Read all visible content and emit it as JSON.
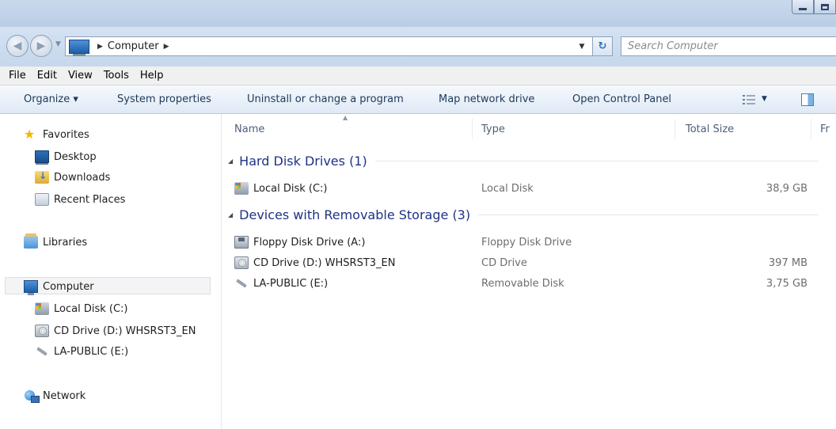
{
  "address": {
    "location": "Computer",
    "search_placeholder": "Search Computer"
  },
  "menu": [
    "File",
    "Edit",
    "View",
    "Tools",
    "Help"
  ],
  "commands": {
    "organize": "Organize ▾",
    "system_properties": "System properties",
    "uninstall": "Uninstall or change a program",
    "map_drive": "Map network drive",
    "control_panel": "Open Control Panel"
  },
  "nav": {
    "favorites": "Favorites",
    "desktop": "Desktop",
    "downloads": "Downloads",
    "recent": "Recent Places",
    "libraries": "Libraries",
    "computer": "Computer",
    "local_disk": "Local Disk (C:)",
    "cd_drive": "CD Drive (D:) WHSRST3_EN",
    "usb": "LA-PUBLIC (E:)",
    "network": "Network"
  },
  "columns": {
    "name": "Name",
    "type": "Type",
    "total_size": "Total Size",
    "free_space": "Fr"
  },
  "groups": {
    "hard_disks": "Hard Disk Drives (1)",
    "removable": "Devices with Removable Storage (3)"
  },
  "drives": {
    "local": {
      "name": "Local Disk (C:)",
      "type": "Local Disk",
      "size": "38,9 GB"
    },
    "floppy": {
      "name": "Floppy Disk Drive (A:)",
      "type": "Floppy Disk Drive",
      "size": ""
    },
    "cd": {
      "name": "CD Drive (D:) WHSRST3_EN",
      "type": "CD Drive",
      "size": "397 MB"
    },
    "usb": {
      "name": "LA-PUBLIC (E:)",
      "type": "Removable Disk",
      "size": "3,75 GB"
    }
  },
  "icons": {
    "back": "back-arrow-icon",
    "forward": "forward-arrow-icon",
    "refresh": "refresh-icon",
    "views": "views-icon",
    "preview": "preview-pane-icon"
  }
}
